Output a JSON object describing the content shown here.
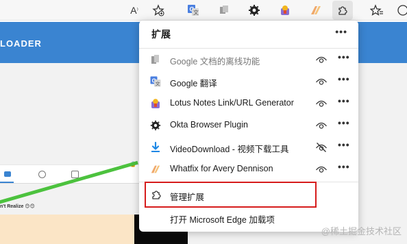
{
  "toolbar": {
    "read_aloud_icon": "A⁾",
    "favorite_add_icon": "☆",
    "translate_icon": "G",
    "ext1_icon": "cube-icon",
    "ext2_icon": "gear-icon",
    "ext3_icon": "lotus-icon",
    "ext4_icon": "whatfix-icon",
    "extensions_icon": "puzzle-icon",
    "favorites_icon": "star-list-icon",
    "profile_icon": "profile-icon"
  },
  "page": {
    "banner_text": "LOADER",
    "thumb_text": "n't Realize 😊😊"
  },
  "popup": {
    "title": "扩展",
    "more": "•••",
    "extensions": [
      {
        "name": "Google 文档的离线功能",
        "icon": "docs-icon",
        "dim": true,
        "visible": true
      },
      {
        "name": "Google 翻译",
        "icon": "translate-icon",
        "dim": false,
        "visible": true
      },
      {
        "name": "Lotus Notes Link/URL Generator",
        "icon": "lotus-icon",
        "dim": false,
        "visible": true
      },
      {
        "name": "Okta Browser Plugin",
        "icon": "okta-icon",
        "dim": false,
        "visible": true
      },
      {
        "name": "VideoDownload - 视频下载工具",
        "icon": "download-icon",
        "dim": false,
        "visible": false
      },
      {
        "name": "Whatfix for Avery Dennison",
        "icon": "whatfix-icon",
        "dim": false,
        "visible": true
      }
    ],
    "manage_label": "管理扩展",
    "addons_label": "打开 Microsoft Edge 加载项"
  },
  "watermark": "@稀土掘金技术社区",
  "colors": {
    "accent_blue": "#3a84d1",
    "highlight_red": "#d61b1b",
    "green_line": "#4cc23e"
  }
}
